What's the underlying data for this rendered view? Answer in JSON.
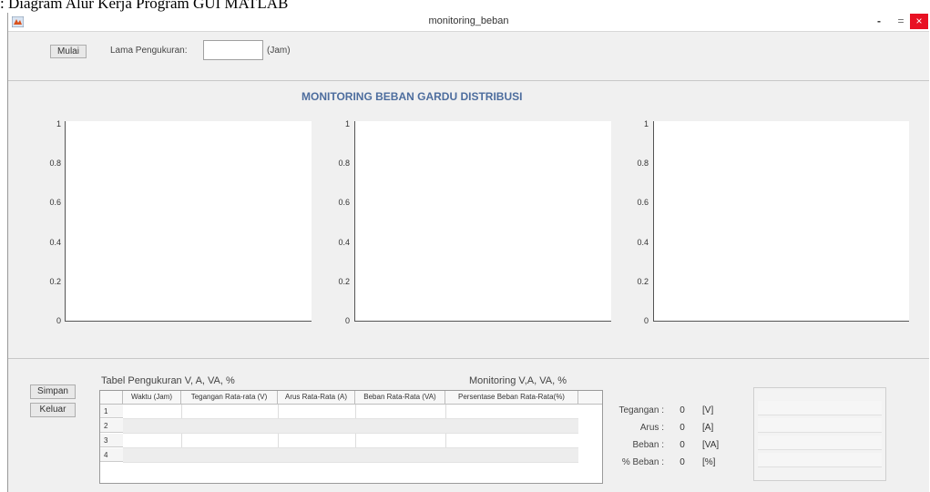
{
  "caption": ":   Diagram Alur Kerja Program GUI MATLAB",
  "window": {
    "title": "monitoring_beban",
    "min_symbol": "-",
    "max_symbol": "=",
    "close_symbol": "×"
  },
  "controls": {
    "start_label": "Mulai",
    "duration_label": "Lama Pengukuran:",
    "duration_value": "",
    "duration_unit": "(Jam)"
  },
  "panel": {
    "title": "MONITORING BEBAN GARDU DISTRIBUSI"
  },
  "axes_ticks": [
    "1",
    "0.8",
    "0.6",
    "0.4",
    "0.2",
    "0"
  ],
  "axes_ylim": [
    0,
    1
  ],
  "buttons": {
    "save": "Simpan",
    "exit": "Keluar"
  },
  "table": {
    "title": "Tabel Pengukuran V, A, VA, %",
    "columns": [
      "Waktu (Jam)",
      "Tegangan Rata-rata (V)",
      "Arus Rata-Rata (A)",
      "Beban Rata-Rata (VA)",
      "Persentase Beban Rata-Rata(%)"
    ],
    "row_numbers": [
      "1",
      "2",
      "3",
      "4"
    ]
  },
  "monitor": {
    "title": "Monitoring V,A, VA, %",
    "rows": [
      {
        "label": "Tegangan :",
        "value": "0",
        "unit": "[V]"
      },
      {
        "label": "Arus :",
        "value": "0",
        "unit": "[A]"
      },
      {
        "label": "Beban :",
        "value": "0",
        "unit": "[VA]"
      },
      {
        "label": "% Beban :",
        "value": "0",
        "unit": "[%]"
      }
    ]
  }
}
